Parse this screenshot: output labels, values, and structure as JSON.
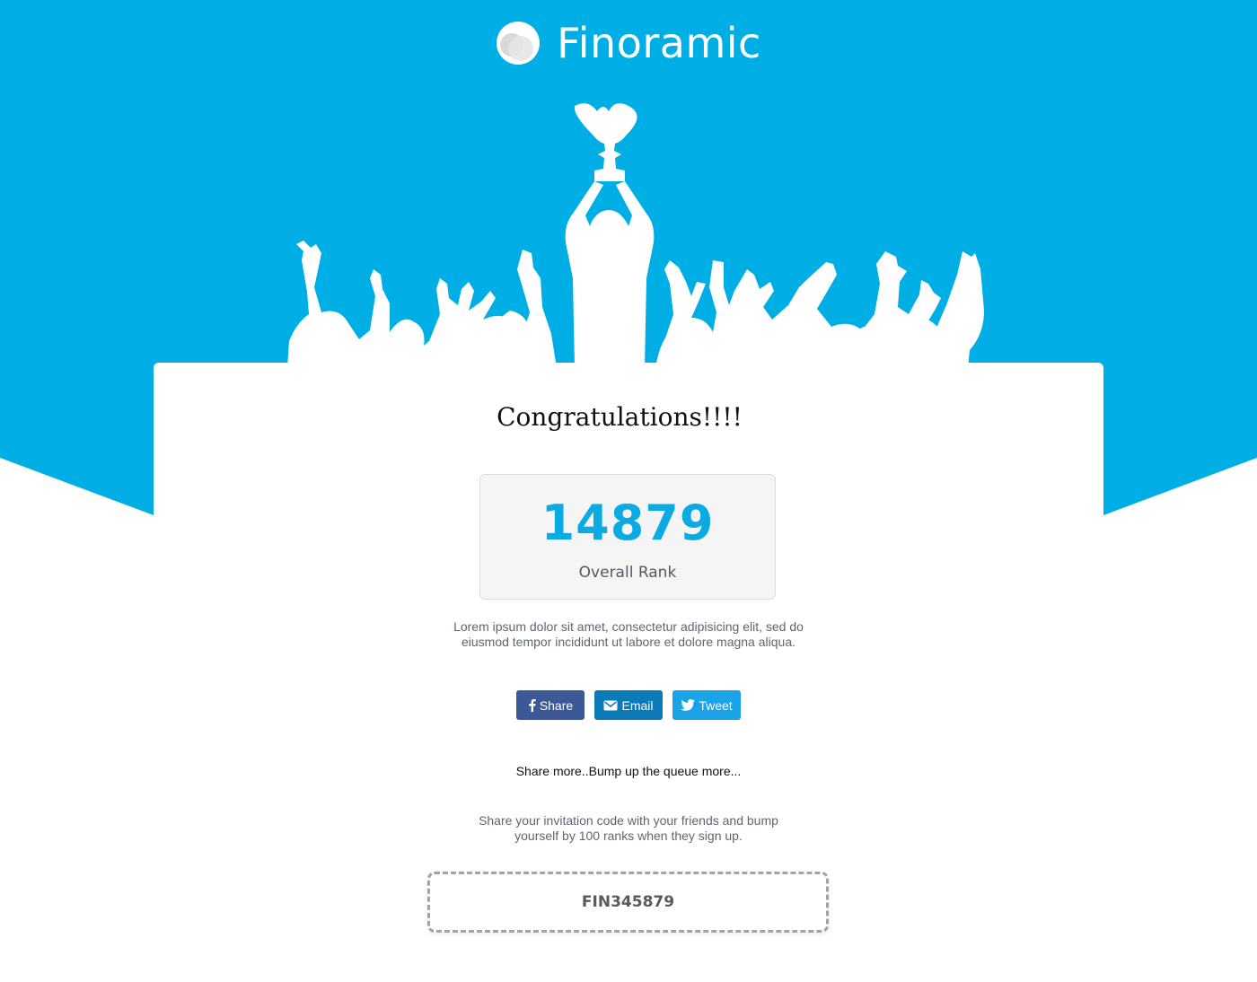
{
  "brand": {
    "name": "Finoramic",
    "logo_icon": "overlapping-circles-logo",
    "background_color": "#00aee6"
  },
  "hero": {
    "illustration": "celebrating-crowd-trophy-icon"
  },
  "card": {
    "title": "Congratulations!!!!",
    "rank": {
      "number": "14879",
      "label": "Overall Rank"
    },
    "description": "Lorem ipsum dolor sit amet, consectetur adipisicing elit, sed do eiusmod tempor incididunt ut labore et dolore magna aliqua.",
    "share_buttons": [
      {
        "label": "Share",
        "icon": "facebook-icon",
        "color": "#3b5997"
      },
      {
        "label": "Email",
        "icon": "envelope-icon",
        "color": "#0a7ab8"
      },
      {
        "label": "Tweet",
        "icon": "twitter-bird-icon",
        "color": "#1ba3e8"
      }
    ],
    "share_more": "Share more..Bump up the queue more...",
    "invite_text": "Share your invitation code with your friends and bump yourself by 100 ranks when they sign up.",
    "invitation_code": "FIN345879"
  },
  "colors": {
    "accent": "#0aabe2",
    "text_muted": "#5f6570"
  }
}
